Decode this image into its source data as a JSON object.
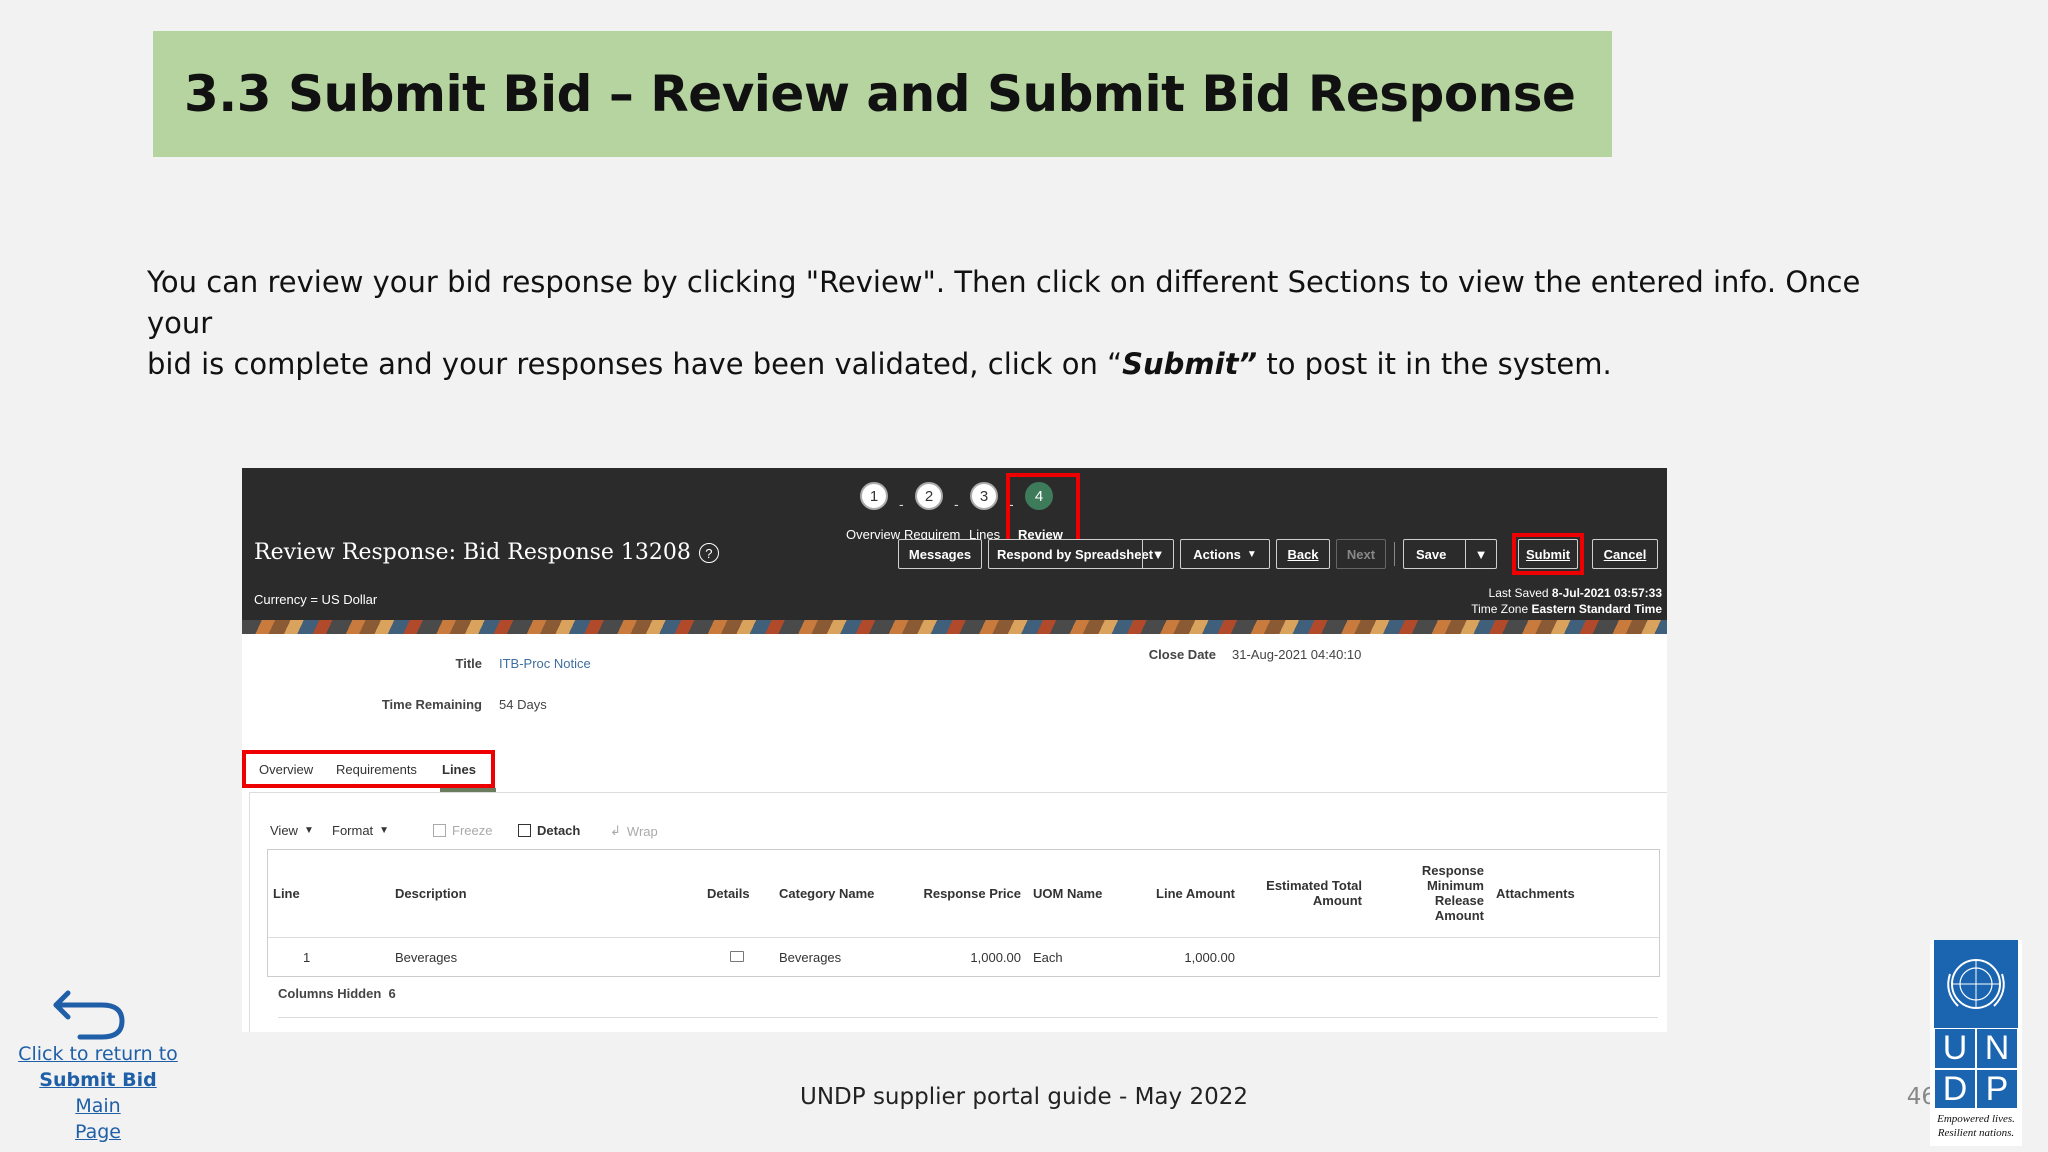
{
  "slide": {
    "title": "3.3 Submit Bid – Review and Submit Bid Response",
    "intro_line1": "You can review your bid response by clicking \"Review\". Then click on different Sections to view the entered info.   Once your",
    "intro_line2_pre": "bid is complete and your responses have been validated, click on “",
    "intro_line2_bold": "Submit”",
    "intro_line2_post": " to post it in the system.",
    "footer": "UNDP supplier portal guide - May 2022",
    "page_number": "46",
    "return_link": {
      "line1": "Click to return to",
      "line2_bold": "Submit Bid ",
      "line2_rest": " Main",
      "line3": "Page"
    },
    "logo": {
      "letters": [
        "U",
        "N",
        "D",
        "P"
      ],
      "tagline1": "Empowered lives.",
      "tagline2": "Resilient nations."
    }
  },
  "app": {
    "train": {
      "steps": [
        {
          "number": "1",
          "label": "Overview"
        },
        {
          "number": "2",
          "label": "Requirem"
        },
        {
          "number": "3",
          "label": "Lines"
        },
        {
          "number": "4",
          "label": "Review",
          "active": true
        }
      ],
      "separator": "-"
    },
    "page_title": "Review Response: Bid Response 13208",
    "help_glyph": "?",
    "buttons": {
      "messages": "Messages",
      "respond_spreadsheet": "Respond by Spreadsheet",
      "actions": "Actions",
      "back": "Back",
      "next": "Next",
      "save": "Save",
      "submit": "Submit",
      "cancel": "Cancel"
    },
    "currency": "Currency = US Dollar",
    "last_saved_label": "Last Saved",
    "last_saved_value": "8-Jul-2021 03:57:33",
    "time_zone_label": "Time Zone",
    "time_zone_value": "Eastern Standard Time",
    "fields": {
      "title_label": "Title",
      "title_value": "ITB-Proc Notice",
      "time_remaining_label": "Time Remaining",
      "time_remaining_value": "54 Days",
      "close_date_label": "Close Date",
      "close_date_value": "31-Aug-2021 04:40:10"
    },
    "tabs": [
      "Overview",
      "Requirements",
      "Lines"
    ],
    "active_tab": "Lines",
    "toolbar": {
      "view": "View",
      "format": "Format",
      "freeze": "Freeze",
      "detach": "Detach",
      "wrap": "Wrap"
    },
    "table": {
      "headers": {
        "line": "Line",
        "description": "Description",
        "details": "Details",
        "category": "Category Name",
        "response_price": "Response Price",
        "uom": "UOM Name",
        "line_amount": "Line Amount",
        "est_total_1": "Estimated Total",
        "est_total_2": "Amount",
        "resp_min_1": "Response",
        "resp_min_2": "Minimum",
        "resp_min_3": "Release",
        "resp_min_4": "Amount",
        "attachments": "Attachments"
      },
      "rows": [
        {
          "line": "1",
          "description": "Beverages",
          "category": "Beverages",
          "response_price": "1,000.00",
          "uom": "Each",
          "line_amount": "1,000.00"
        }
      ]
    },
    "columns_hidden_label": "Columns Hidden",
    "columns_hidden_value": "6"
  },
  "colors": {
    "banner": "#b5d49f",
    "header_bg": "#2b2b2b",
    "active_step": "#3e7b5a",
    "highlight": "#e00000",
    "link": "#1f5fa8",
    "undp_blue": "#1a64b0"
  }
}
